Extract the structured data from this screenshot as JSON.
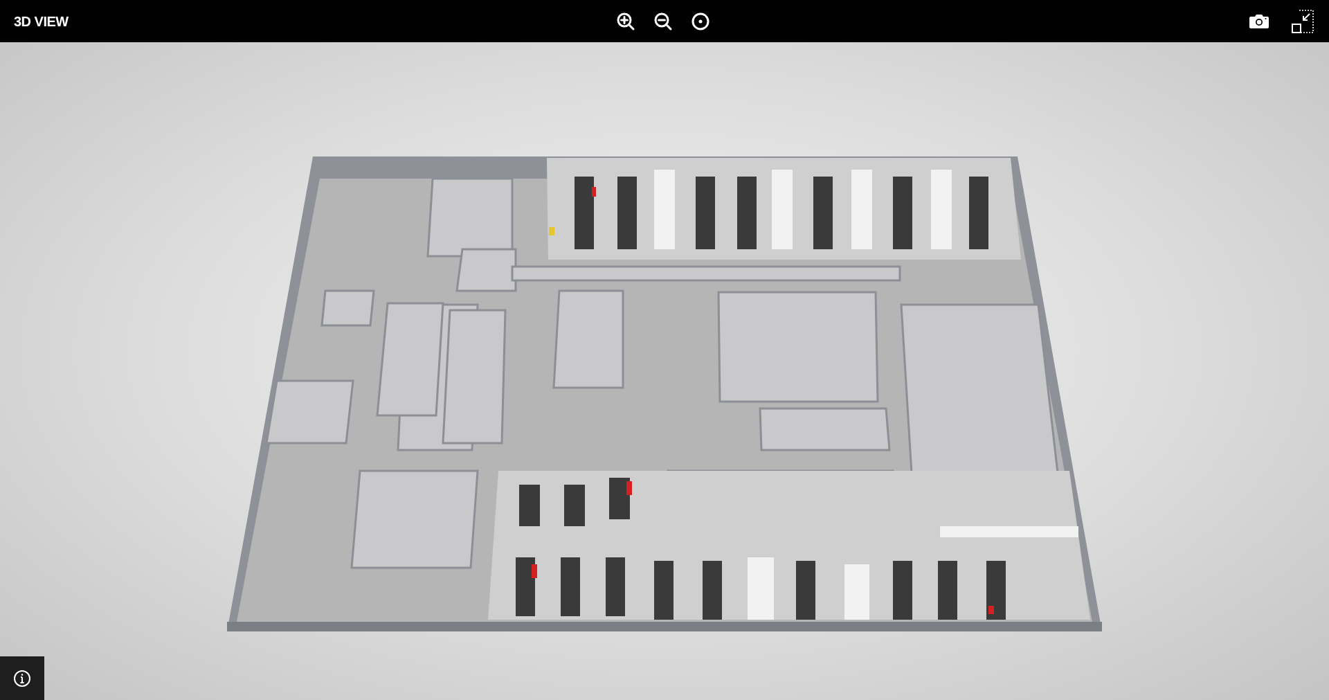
{
  "header": {
    "title": "3D VIEW"
  }
}
